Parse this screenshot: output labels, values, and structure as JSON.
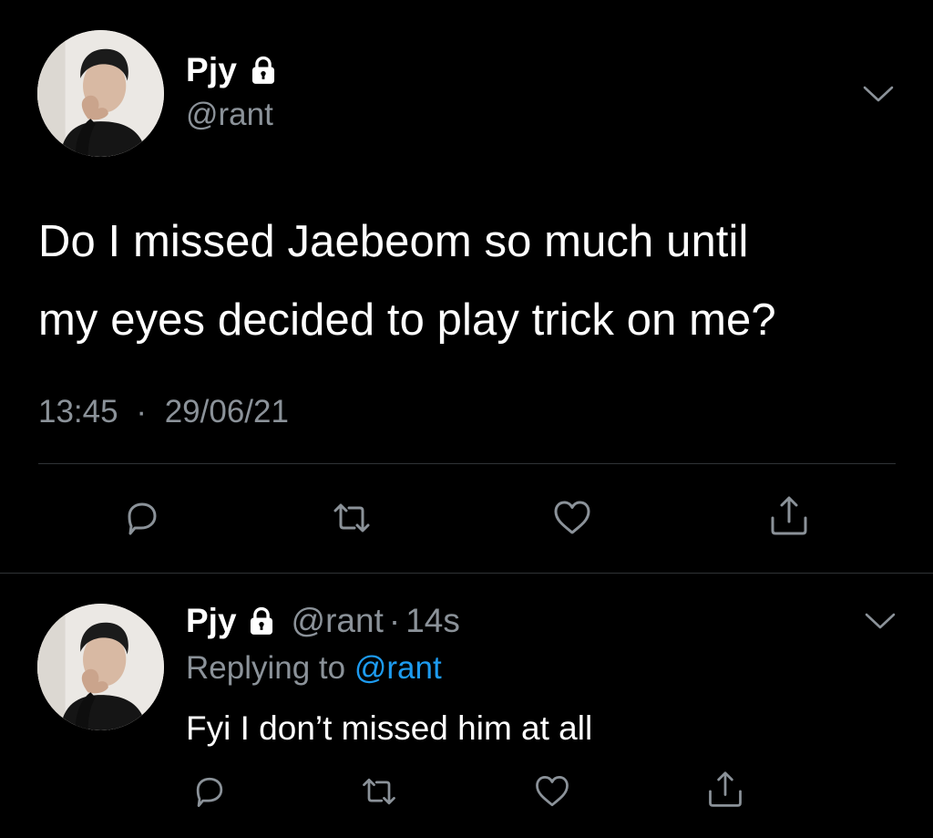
{
  "tweet": {
    "author_name": "Pjy",
    "author_handle": "@rant",
    "text_line1": "Do I missed Jaebeom so much until",
    "text_line2": "my eyes decided to play trick on me?",
    "time": "13:45",
    "separator": "·",
    "date": "29/06/21"
  },
  "reply": {
    "author_name": "Pjy",
    "author_handle": "@rant",
    "separator": "·",
    "age": "14s",
    "replying_prefix": "Replying to",
    "replying_mention": "@rant",
    "text": "Fyi I don’t missed him at all"
  },
  "icons": {
    "lock": "lock-icon",
    "chevron": "chevron-down-icon",
    "reply": "reply-icon",
    "retweet": "retweet-icon",
    "like": "heart-icon",
    "share": "share-icon"
  },
  "colors": {
    "background": "#000000",
    "text": "#ffffff",
    "secondary": "#8b9299",
    "link": "#1d9bf0",
    "divider": "#2f3336"
  }
}
